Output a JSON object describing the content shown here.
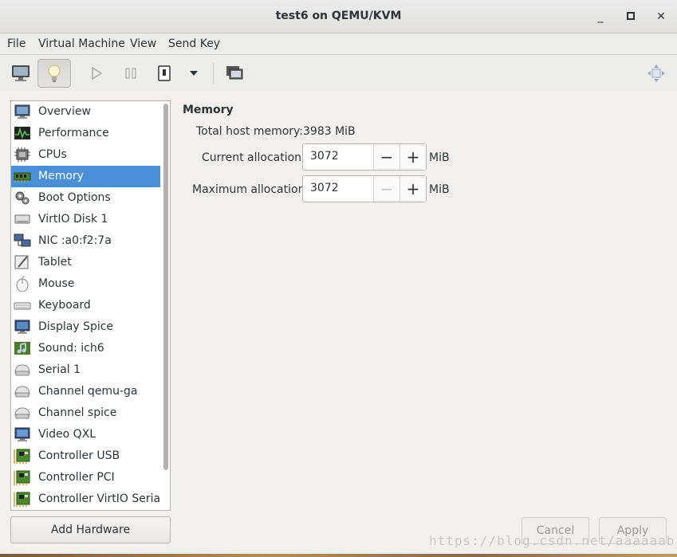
{
  "window": {
    "title": "test6 on QEMU/KVM"
  },
  "window_controls": {
    "minimize": "_",
    "maximize": "□",
    "close": "✕"
  },
  "menu": {
    "items": [
      "File",
      "Virtual Machine",
      "View",
      "Send Key"
    ]
  },
  "toolbar": {
    "buttons": [
      "console-icon",
      "details-icon",
      "run-icon",
      "pause-icon",
      "shutdown-icon",
      "dropdown-icon",
      "snapshots-icon",
      "fullscreen-icon"
    ],
    "active": "details-icon"
  },
  "sidebar": {
    "selected": "Memory",
    "items": [
      {
        "label": "Overview",
        "icon": "monitor-icon"
      },
      {
        "label": "Performance",
        "icon": "performance-icon"
      },
      {
        "label": "CPUs",
        "icon": "cpu-icon"
      },
      {
        "label": "Memory",
        "icon": "memory-icon"
      },
      {
        "label": "Boot Options",
        "icon": "gears-icon"
      },
      {
        "label": "VirtIO Disk 1",
        "icon": "disk-icon"
      },
      {
        "label": "NIC :a0:f2:7a",
        "icon": "network-icon"
      },
      {
        "label": "Tablet",
        "icon": "tablet-icon"
      },
      {
        "label": "Mouse",
        "icon": "mouse-icon"
      },
      {
        "label": "Keyboard",
        "icon": "keyboard-icon"
      },
      {
        "label": "Display Spice",
        "icon": "display-icon"
      },
      {
        "label": "Sound: ich6",
        "icon": "sound-icon"
      },
      {
        "label": "Serial 1",
        "icon": "serial-icon"
      },
      {
        "label": "Channel qemu-ga",
        "icon": "channel-icon"
      },
      {
        "label": "Channel spice",
        "icon": "channel-icon"
      },
      {
        "label": "Video QXL",
        "icon": "video-icon"
      },
      {
        "label": "Controller USB",
        "icon": "controller-icon"
      },
      {
        "label": "Controller PCI",
        "icon": "controller-icon"
      },
      {
        "label": "Controller VirtIO Serial",
        "icon": "controller-icon"
      }
    ]
  },
  "memory": {
    "title": "Memory",
    "total_label": "Total host memory:",
    "total_value": "3983 MiB",
    "current_label": "Current allocation:",
    "current_value": "3072",
    "current_unit": "MiB",
    "maximum_label": "Maximum allocation:",
    "maximum_value": "3072",
    "maximum_unit": "MiB",
    "minus": "−",
    "plus": "+"
  },
  "footer": {
    "add_hardware": "Add Hardware",
    "cancel": "Cancel",
    "apply": "Apply"
  },
  "watermark": "https://blog.csdn.net/aaaaaab_"
}
